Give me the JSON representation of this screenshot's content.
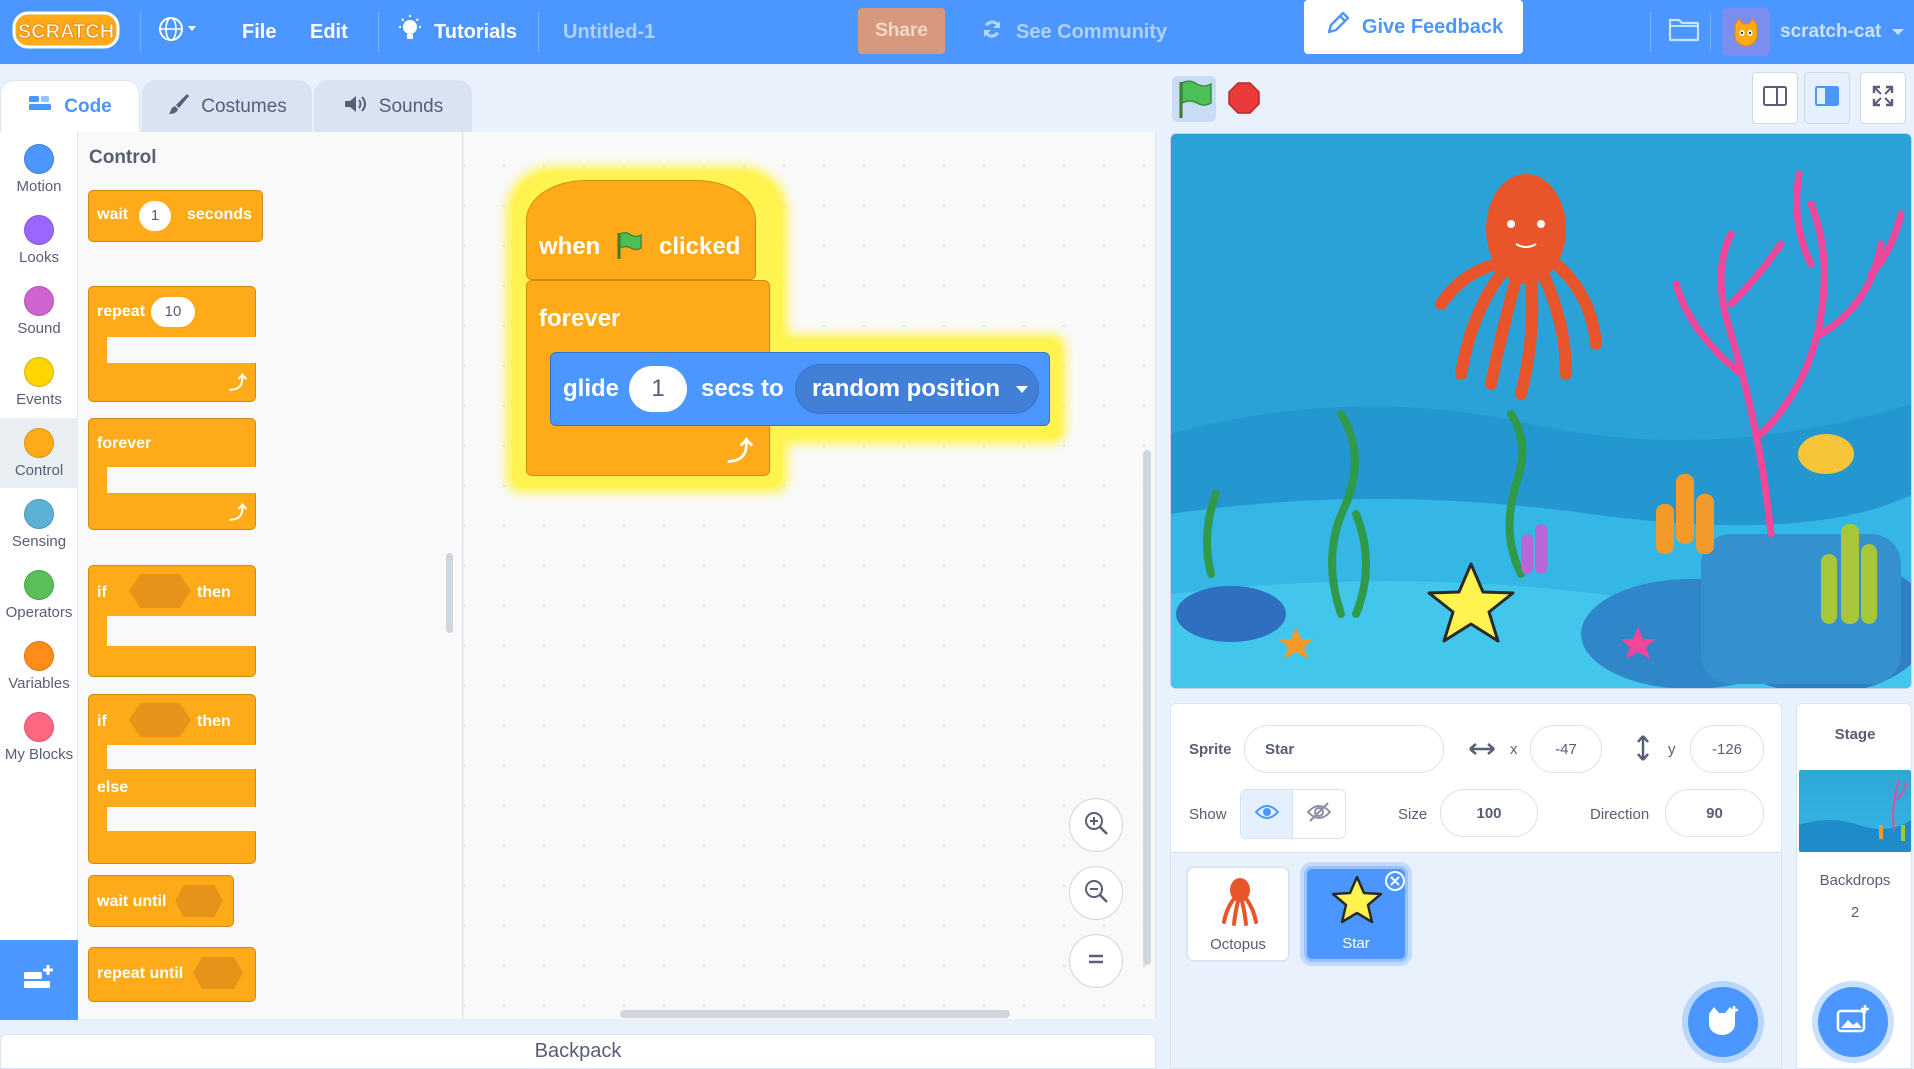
{
  "menubar": {
    "logo": "SCRATCH",
    "file": "File",
    "edit": "Edit",
    "tutorials": "Tutorials",
    "project_title": "Untitled-1",
    "share": "Share",
    "see_community": "See Community",
    "give_feedback": "Give Feedback",
    "username": "scratch-cat"
  },
  "tabs": [
    {
      "label": "Code",
      "icon": "code-icon"
    },
    {
      "label": "Costumes",
      "icon": "brush-icon"
    },
    {
      "label": "Sounds",
      "icon": "speaker-icon"
    }
  ],
  "categories": [
    {
      "label": "Motion",
      "color": "#4c97ff"
    },
    {
      "label": "Looks",
      "color": "#9966ff"
    },
    {
      "label": "Sound",
      "color": "#cf63cf"
    },
    {
      "label": "Events",
      "color": "#ffd500"
    },
    {
      "label": "Control",
      "color": "#ffab19"
    },
    {
      "label": "Sensing",
      "color": "#5cb1d6"
    },
    {
      "label": "Operators",
      "color": "#59c059"
    },
    {
      "label": "Variables",
      "color": "#ff8c1a"
    },
    {
      "label": "My Blocks",
      "color": "#ff6680"
    }
  ],
  "palette": {
    "title": "Control",
    "wait": "wait",
    "wait_value": "1",
    "seconds": "seconds",
    "repeat": "repeat",
    "repeat_value": "10",
    "forever": "forever",
    "if1": "if",
    "then1": "then",
    "if2": "if",
    "then2": "then",
    "else": "else",
    "wait_until": "wait until",
    "repeat_until": "repeat until"
  },
  "script": {
    "when": "when",
    "clicked": "clicked",
    "forever": "forever",
    "glide": "glide",
    "glide_value": "1",
    "secs_to": "secs to",
    "target": "random position"
  },
  "sprite_info": {
    "sprite_label": "Sprite",
    "sprite_name": "Star",
    "x_label": "x",
    "x_value": "-47",
    "y_label": "y",
    "y_value": "-126",
    "show_label": "Show",
    "size_label": "Size",
    "size_value": "100",
    "direction_label": "Direction",
    "direction_value": "90"
  },
  "sprites": [
    {
      "name": "Octopus",
      "selected": false
    },
    {
      "name": "Star",
      "selected": true
    }
  ],
  "stage_panel": {
    "title": "Stage",
    "backdrops_label": "Backdrops",
    "backdrops_count": "2"
  },
  "backpack": "Backpack",
  "colors": {
    "menubar": "#4c97ff",
    "control": "#ffab19",
    "motion": "#4c97ff",
    "highlight": "#fff200",
    "share": "#d7997d"
  }
}
